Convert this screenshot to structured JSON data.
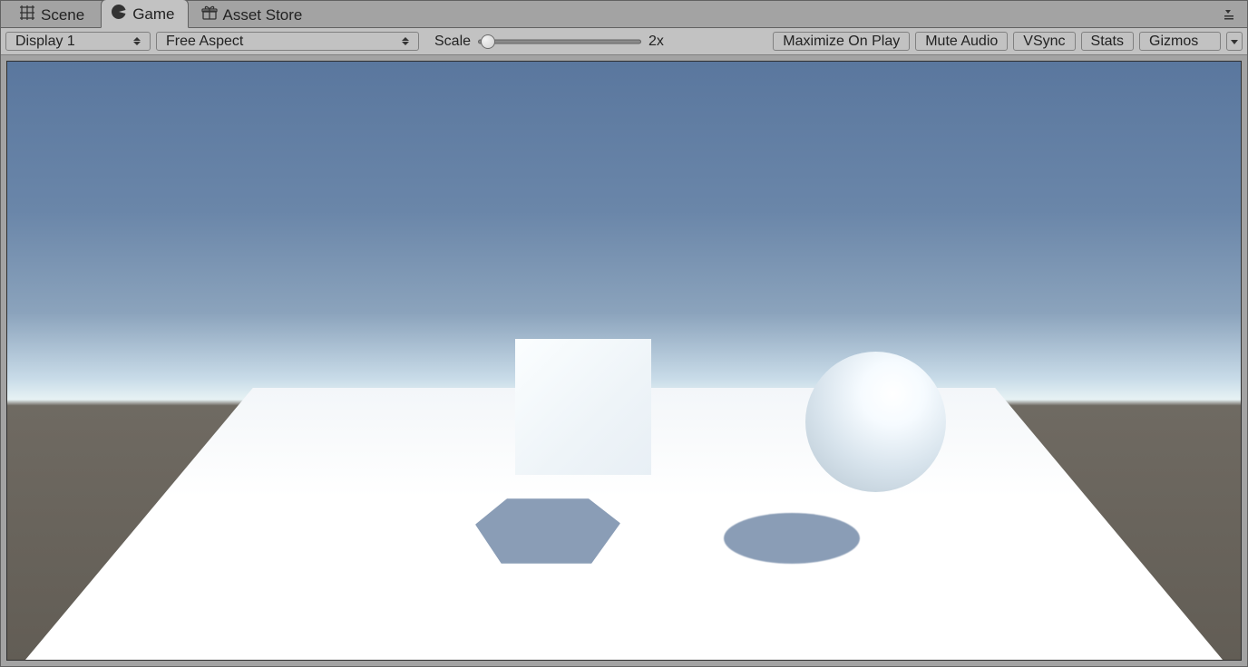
{
  "tabs": {
    "scene": "Scene",
    "game": "Game",
    "asset_store": "Asset Store"
  },
  "toolbar": {
    "display": "Display 1",
    "aspect": "Free Aspect",
    "scale_label": "Scale",
    "scale_value": "2x",
    "maximize": "Maximize On Play",
    "mute": "Mute Audio",
    "vsync": "VSync",
    "stats": "Stats",
    "gizmos": "Gizmos"
  },
  "icons": {
    "scene": "scene-grid-icon",
    "game": "pacman-icon",
    "asset_store": "gift-icon",
    "options": "options-icon"
  }
}
